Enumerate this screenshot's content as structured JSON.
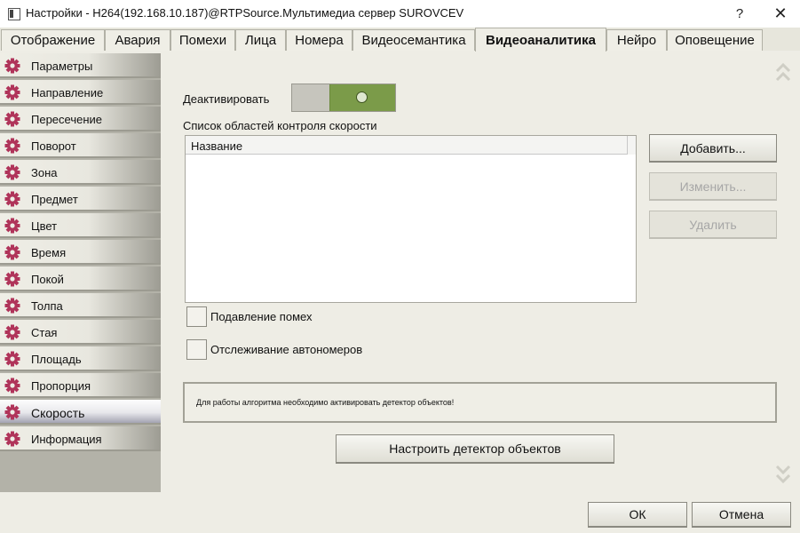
{
  "window": {
    "title": "Настройки - H264(192.168.10.187)@RTPSource.Мультимедиа сервер SUROVCEV",
    "help_label": "?",
    "close_label": "✕"
  },
  "tabs": [
    {
      "label": "Отображение",
      "active": false
    },
    {
      "label": "Авария",
      "active": false
    },
    {
      "label": "Помехи",
      "active": false
    },
    {
      "label": "Лица",
      "active": false
    },
    {
      "label": "Номера",
      "active": false
    },
    {
      "label": "Видеосемантика",
      "active": false
    },
    {
      "label": "Видеоаналитика",
      "active": true
    },
    {
      "label": "Нейро",
      "active": false
    },
    {
      "label": "Оповещение",
      "active": false
    }
  ],
  "sidebar": {
    "items": [
      {
        "label": "Параметры"
      },
      {
        "label": "Направление"
      },
      {
        "label": "Пересечение"
      },
      {
        "label": "Поворот"
      },
      {
        "label": "Зона"
      },
      {
        "label": "Предмет"
      },
      {
        "label": "Цвет"
      },
      {
        "label": "Время"
      },
      {
        "label": "Покой"
      },
      {
        "label": "Толпа"
      },
      {
        "label": "Стая"
      },
      {
        "label": "Площадь"
      },
      {
        "label": "Пропорция"
      },
      {
        "label": "Скорость"
      },
      {
        "label": "Информация"
      }
    ],
    "active_index": 13,
    "icon": "gear-icon",
    "icon_color": "#b0345a"
  },
  "main": {
    "deactivate_label": "Деактивировать",
    "toggle_on": true,
    "list_caption": "Список областей контроля скорости",
    "list_column": "Название",
    "buttons": {
      "add": "Добавить...",
      "edit": "Изменить...",
      "delete": "Удалить"
    },
    "checkbox_noise": {
      "label": "Подавление помех",
      "checked": false
    },
    "checkbox_plates": {
      "label": "Отслеживание автономеров",
      "checked": false
    },
    "info_text": "Для работы алгоритма необходимо активировать детектор объектов!",
    "configure_label": "Настроить детектор объектов"
  },
  "footer": {
    "ok_label": "ОК",
    "cancel_label": "Отмена"
  },
  "colors": {
    "toggle_accent": "#7b9b49",
    "gear": "#b0345a"
  }
}
